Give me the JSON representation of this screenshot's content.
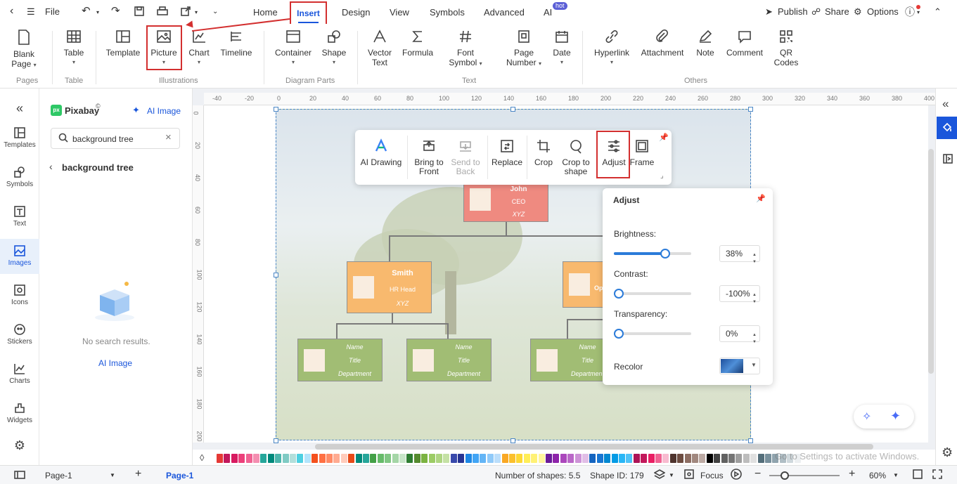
{
  "topbar": {
    "file": "File",
    "tabs": [
      "Home",
      "Insert",
      "Design",
      "View",
      "Symbols",
      "Advanced",
      "AI"
    ],
    "hot_badge": "hot",
    "publish": "Publish",
    "share": "Share",
    "options": "Options"
  },
  "ribbon": {
    "blank_page": [
      "Blank",
      "Page"
    ],
    "table": "Table",
    "template": "Template",
    "picture": "Picture",
    "chart": "Chart",
    "timeline": "Timeline",
    "container": "Container",
    "shape": "Shape",
    "vector_text": [
      "Vector",
      "Text"
    ],
    "formula": "Formula",
    "font_symbol": [
      "Font",
      "Symbol"
    ],
    "page_number": [
      "Page",
      "Number"
    ],
    "date": "Date",
    "hyperlink": "Hyperlink",
    "attachment": "Attachment",
    "note": "Note",
    "comment": "Comment",
    "qr_codes": [
      "QR",
      "Codes"
    ],
    "groups": [
      "Pages",
      "Table",
      "Illustrations",
      "Diagram Parts",
      "Text",
      "Others"
    ]
  },
  "leftbar": [
    "Templates",
    "Symbols",
    "Text",
    "Images",
    "Icons",
    "Stickers",
    "Charts",
    "Widgets"
  ],
  "panel": {
    "source": "Pixabay",
    "source_mark": "©",
    "ai_image_link": "AI Image",
    "search_value": "background tree",
    "breadcrumb": "background tree",
    "empty_text": "No search results.",
    "ai_image_button": "AI Image"
  },
  "ruler_h": [
    "-40",
    "-20",
    "0",
    "20",
    "40",
    "60",
    "80",
    "100",
    "120",
    "140",
    "160",
    "180",
    "200",
    "220",
    "240",
    "260",
    "280",
    "300",
    "320",
    "340",
    "360",
    "380",
    "400"
  ],
  "ruler_v": [
    "0",
    "20",
    "40",
    "60",
    "80",
    "100",
    "120",
    "140",
    "160",
    "180",
    "200"
  ],
  "chart_nodes": {
    "ceo": {
      "name": "John",
      "title": "CEO",
      "dept": "XYZ"
    },
    "hr": {
      "name": "Smith",
      "title": "HR Head",
      "dept": "XYZ"
    },
    "op": {
      "title": "Op"
    },
    "leaf": {
      "name": "Name",
      "title": "Title",
      "dept": "Department"
    }
  },
  "float_toolbar": {
    "ai_drawing": "AI Drawing",
    "bring_front": [
      "Bring to",
      "Front"
    ],
    "send_back": [
      "Send to",
      "Back"
    ],
    "replace": "Replace",
    "crop": "Crop",
    "crop_shape": [
      "Crop to",
      "shape"
    ],
    "adjust": "Adjust",
    "frame": "Frame"
  },
  "adjust_panel": {
    "title": "Adjust",
    "brightness_label": "Brightness:",
    "brightness_value": "38%",
    "brightness_fraction": 0.66,
    "contrast_label": "Contrast:",
    "contrast_value": "-100%",
    "contrast_fraction": 0,
    "transparency_label": "Transparency:",
    "transparency_value": "0%",
    "transparency_fraction": 0,
    "recolor_label": "Recolor"
  },
  "status": {
    "page_select": "Page-1",
    "page_tab": "Page-1",
    "shapes": "Number of shapes: 5.5",
    "shape_id": "Shape ID: 179",
    "focus": "Focus",
    "zoom": "60%"
  },
  "watermark": "Go to Settings to activate Windows.",
  "colors": {
    "accent": "#1a56db",
    "highlight": "#d32f2f",
    "palette": [
      "#e53935",
      "#c2185b",
      "#d81b60",
      "#ec407a",
      "#f06292",
      "#f48fb1",
      "#26a69a",
      "#00897b",
      "#4db6ac",
      "#80cbc4",
      "#b2dfdb",
      "#4dd0e1",
      "#b3e5fc",
      "#f4511e",
      "#ff7043",
      "#ff8a65",
      "#ffab91",
      "#ffccbc",
      "#e64a19",
      "#00897b",
      "#26a69a",
      "#43a047",
      "#66bb6a",
      "#81c784",
      "#a5d6a7",
      "#c8e6c9",
      "#2e7d32",
      "#558b2f",
      "#7cb342",
      "#9ccc65",
      "#aed581",
      "#c5e1a5",
      "#3949ab",
      "#283593",
      "#1e88e5",
      "#42a5f5",
      "#64b5f6",
      "#90caf9",
      "#bbdefb",
      "#f9a825",
      "#fbc02d",
      "#fdd835",
      "#ffee58",
      "#fff176",
      "#fff59d",
      "#6a1b9a",
      "#8e24aa",
      "#ab47bc",
      "#ba68c8",
      "#ce93d8",
      "#e1bee7",
      "#1565c0",
      "#1976d2",
      "#0288d1",
      "#039be5",
      "#29b6f6",
      "#4fc3f7",
      "#ad1457",
      "#c2185b",
      "#e91e63",
      "#f06292",
      "#f8bbd0",
      "#4e342e",
      "#6d4c41",
      "#8d6e63",
      "#a1887f",
      "#bcaaa4",
      "#000000",
      "#424242",
      "#616161",
      "#757575",
      "#9e9e9e",
      "#bdbdbd",
      "#e0e0e0",
      "#546e7a",
      "#78909c",
      "#90a4ae",
      "#b0bec5",
      "#cfd8dc",
      "#eceff1"
    ]
  }
}
